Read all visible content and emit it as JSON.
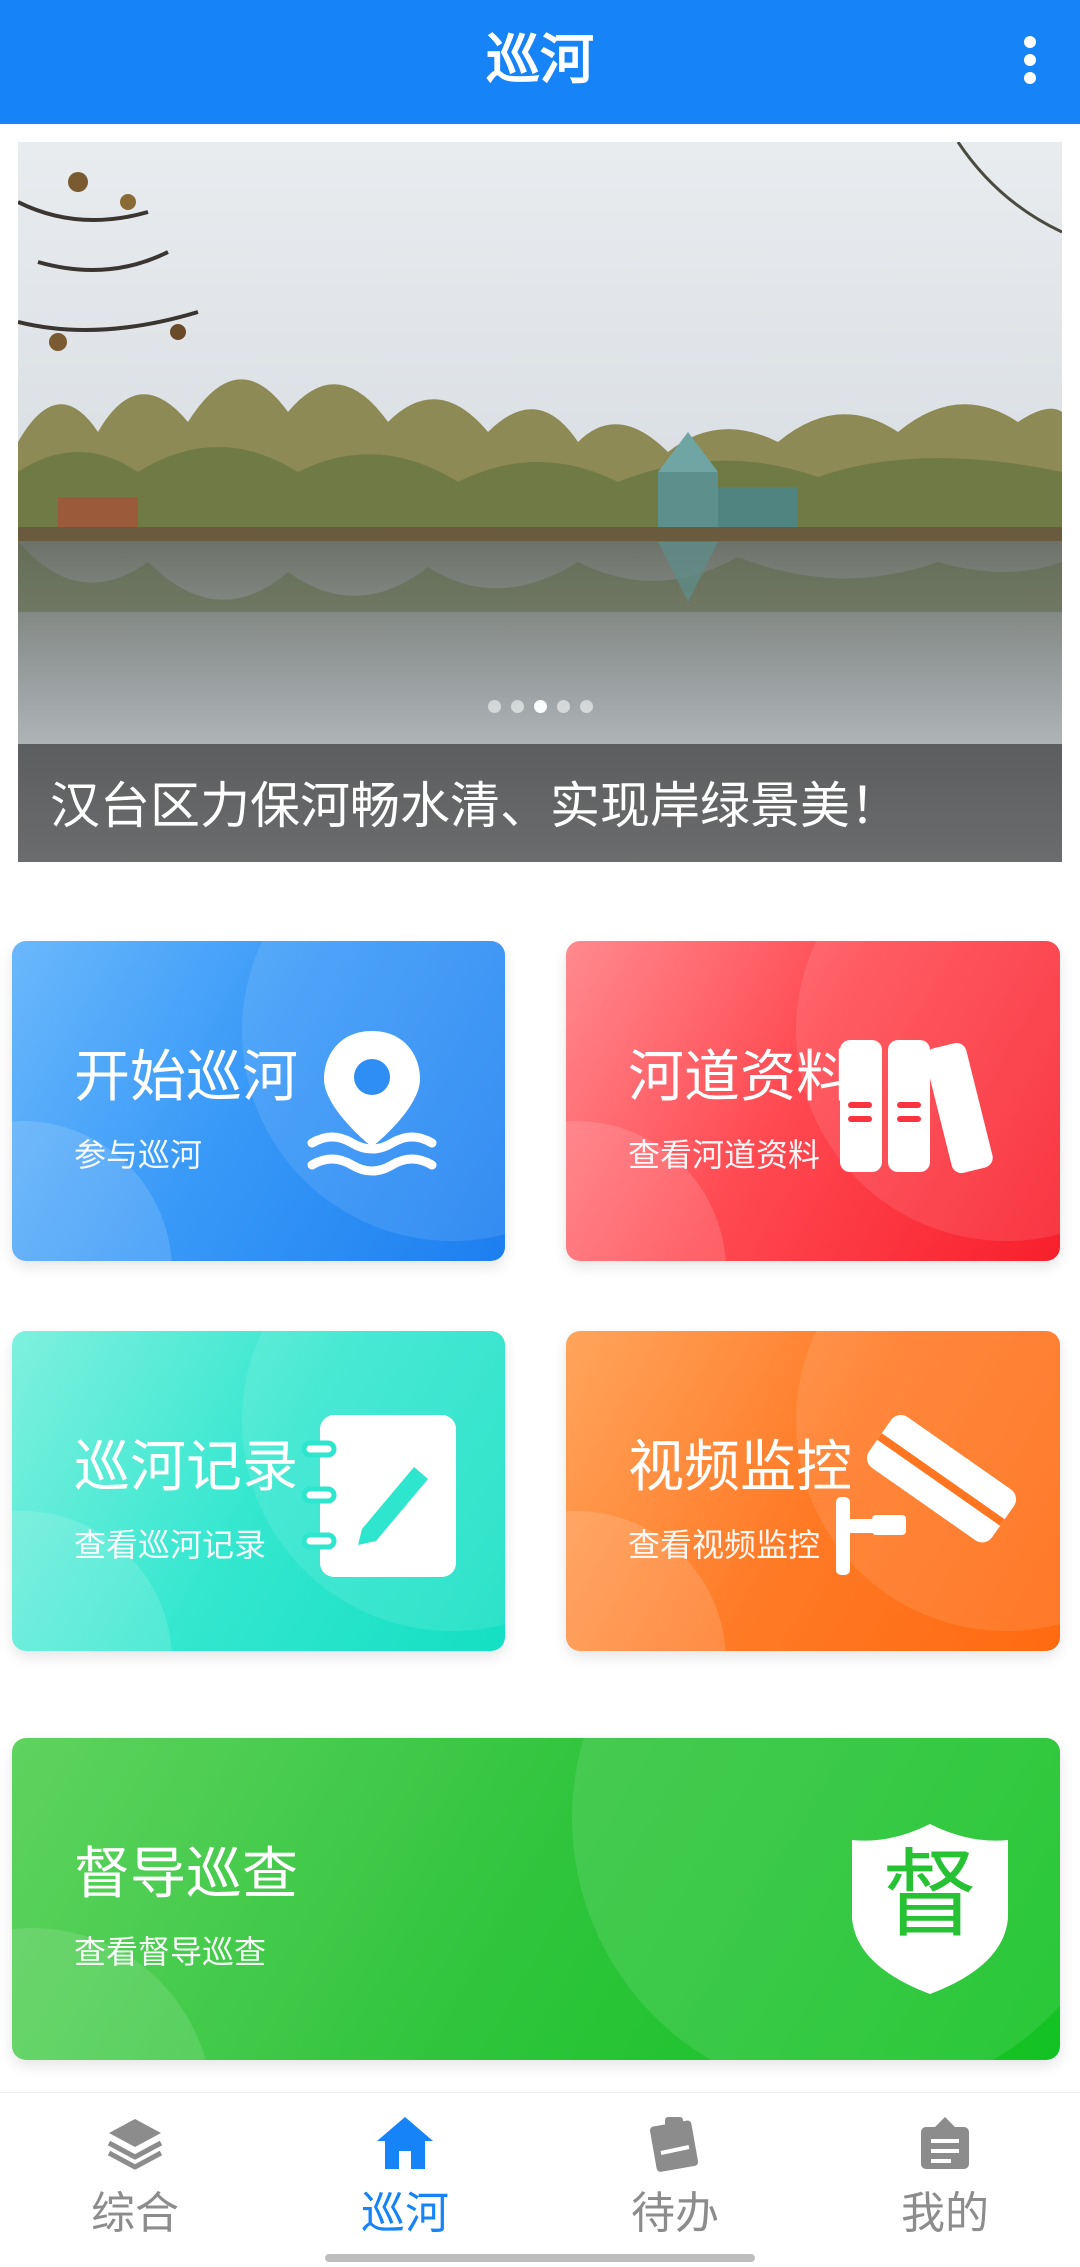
{
  "header": {
    "title": "巡河",
    "more_icon": "more-vertical-icon"
  },
  "banner": {
    "caption": "汉台区力保河畅水清、实现岸绿景美！",
    "slide_count": 5,
    "active_slide": 3
  },
  "cards": {
    "start_patrol": {
      "title": "开始巡河",
      "subtitle": "参与巡河",
      "icon": "location-water-icon",
      "color": "#2a8ef5"
    },
    "river_data": {
      "title": "河道资料",
      "subtitle": "查看河道资料",
      "icon": "books-icon",
      "color": "#fb3440"
    },
    "patrol_records": {
      "title": "巡河记录",
      "subtitle": "查看巡河记录",
      "icon": "notebook-pen-icon",
      "color": "#2ee6cd"
    },
    "video_monitor": {
      "title": "视频监控",
      "subtitle": "查看视频监控",
      "icon": "cctv-camera-icon",
      "color": "#ff7520"
    },
    "supervision": {
      "title": "督导巡查",
      "subtitle": "查看督导巡查",
      "icon": "shield-badge-icon",
      "badge_text": "督",
      "color": "#27c233"
    }
  },
  "tabbar": {
    "items": [
      {
        "label": "综合",
        "icon": "layers-icon",
        "active": false
      },
      {
        "label": "巡河",
        "icon": "home-icon",
        "active": true
      },
      {
        "label": "待办",
        "icon": "clipboard-icon",
        "active": false
      },
      {
        "label": "我的",
        "icon": "profile-card-icon",
        "active": false
      }
    ],
    "active_color": "#1683f7",
    "inactive_color": "#8c8c8c"
  }
}
